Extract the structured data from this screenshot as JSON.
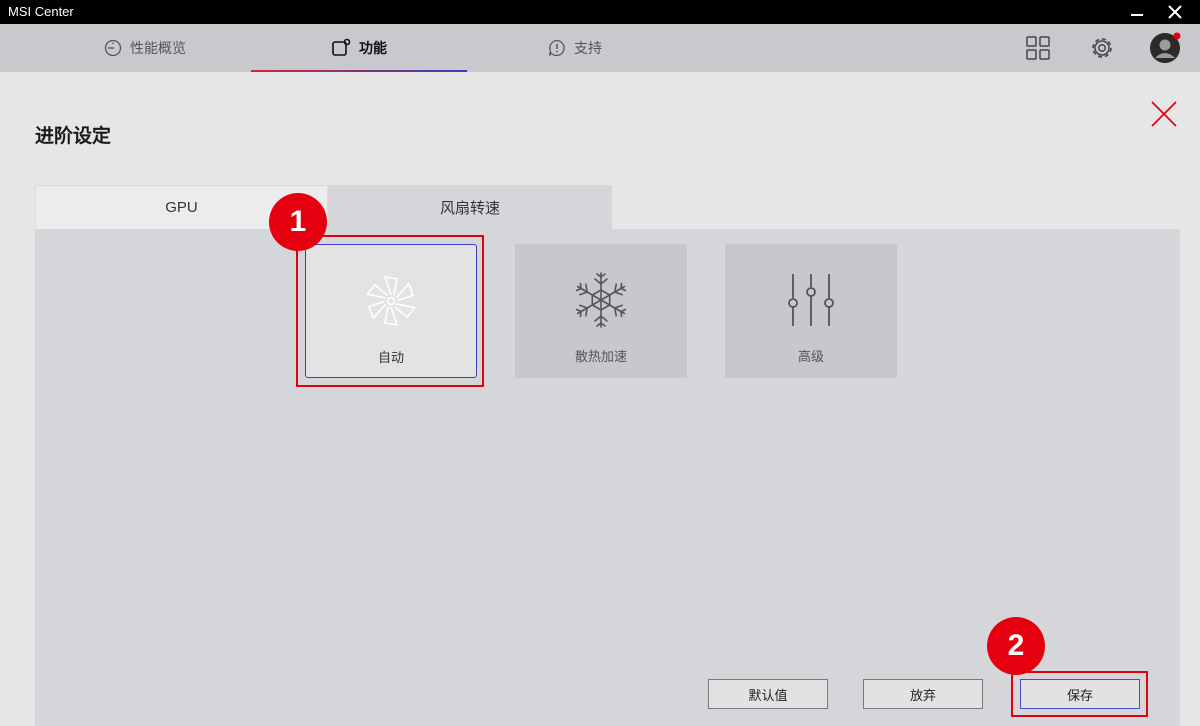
{
  "window": {
    "title": "MSI Center"
  },
  "nav": {
    "tabs": [
      {
        "label": "性能概览",
        "icon": "gauge-icon"
      },
      {
        "label": "功能",
        "icon": "feature-icon",
        "active": true
      },
      {
        "label": "支持",
        "icon": "support-icon"
      }
    ],
    "right_icons": [
      "grid-icon",
      "gear-icon",
      "avatar"
    ],
    "accent": "#d3243c"
  },
  "dialog": {
    "title": "进阶设定",
    "tabs": [
      {
        "label": "GPU"
      },
      {
        "label": "风扇转速",
        "active": true
      }
    ],
    "modes": [
      {
        "label": "自动",
        "icon": "fan-icon",
        "selected": true
      },
      {
        "label": "散热加速",
        "icon": "snowflake-icon"
      },
      {
        "label": "高级",
        "icon": "sliders-icon"
      }
    ],
    "buttons": {
      "default": "默认值",
      "discard": "放弃",
      "save": "保存"
    }
  },
  "annotations": {
    "badge1": "1",
    "badge2": "2",
    "color": "#e5000f"
  }
}
